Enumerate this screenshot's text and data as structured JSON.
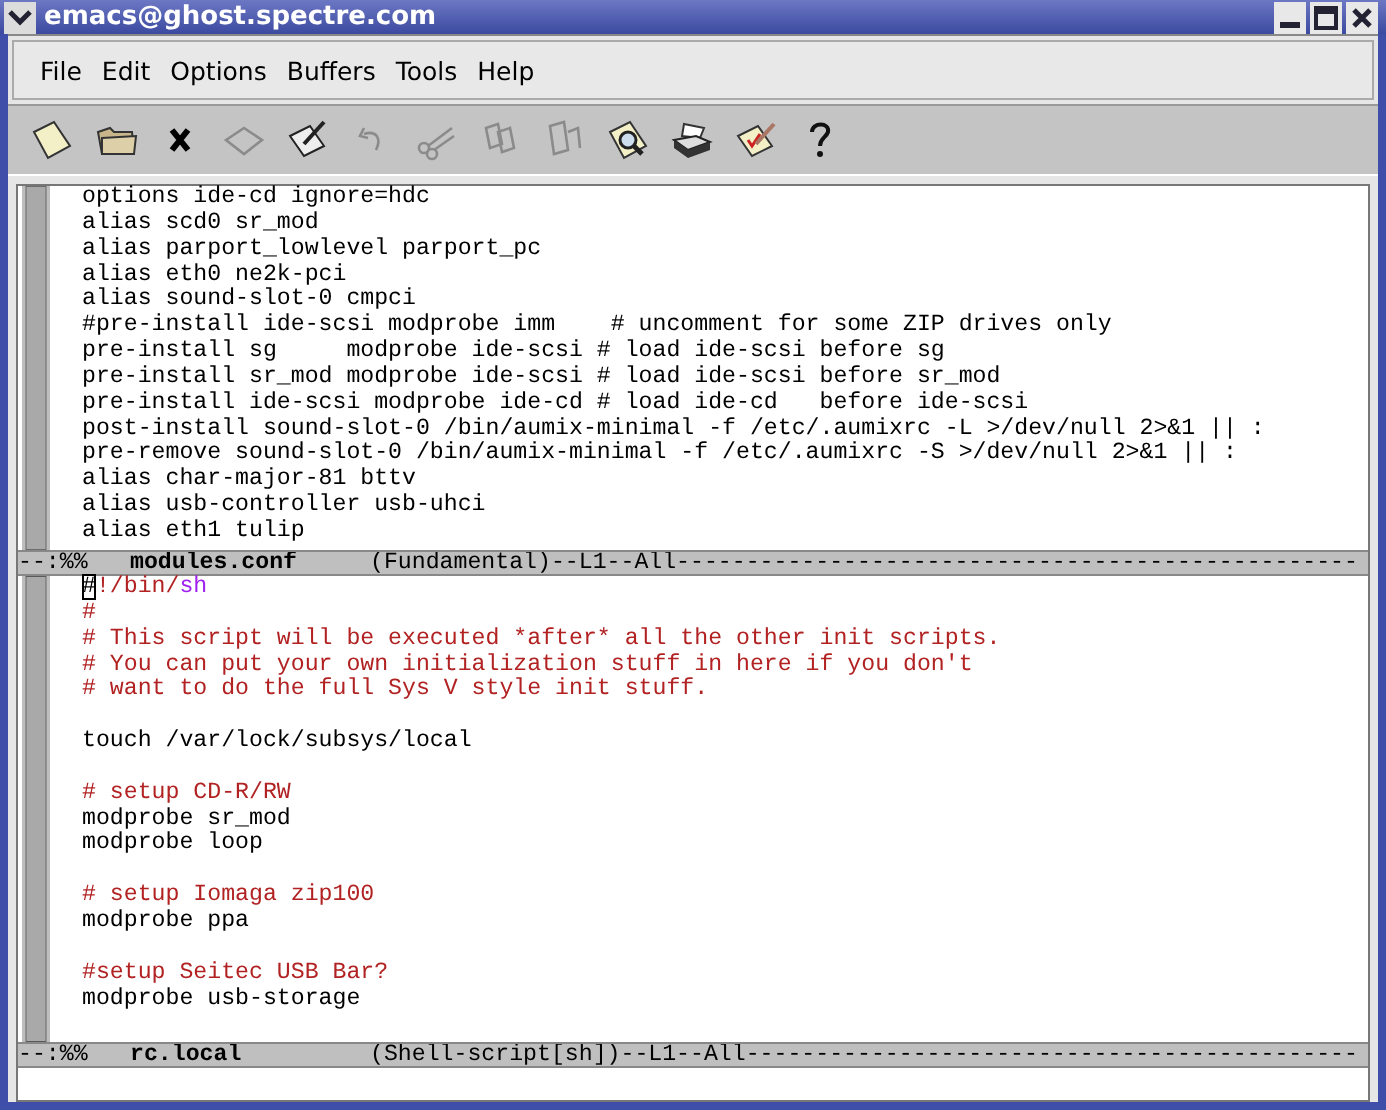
{
  "window": {
    "title": "emacs@ghost.spectre.com"
  },
  "menu": [
    {
      "label": "File"
    },
    {
      "label": "Edit"
    },
    {
      "label": "Options"
    },
    {
      "label": "Buffers"
    },
    {
      "label": "Tools"
    },
    {
      "label": "Help"
    }
  ],
  "toolbar": [
    {
      "kind": "new",
      "disabled": false
    },
    {
      "kind": "open",
      "disabled": false
    },
    {
      "kind": "close",
      "disabled": false
    },
    {
      "kind": "save",
      "disabled": true
    },
    {
      "kind": "edit",
      "disabled": false
    },
    {
      "kind": "undo",
      "disabled": true
    },
    {
      "kind": "cut",
      "disabled": true
    },
    {
      "kind": "copy",
      "disabled": true
    },
    {
      "kind": "paste",
      "disabled": true
    },
    {
      "kind": "search",
      "disabled": false
    },
    {
      "kind": "print",
      "disabled": false
    },
    {
      "kind": "check",
      "disabled": false
    },
    {
      "kind": "help",
      "disabled": false
    }
  ],
  "panes": [
    {
      "lines": [
        {
          "kind": "text",
          "segments": [
            {
              "kind": "code",
              "text": "options ide-cd ignore=hdc"
            }
          ]
        },
        {
          "kind": "text",
          "segments": [
            {
              "kind": "code",
              "text": "alias scd0 sr_mod"
            }
          ]
        },
        {
          "kind": "text",
          "segments": [
            {
              "kind": "code",
              "text": "alias parport_lowlevel parport_pc"
            }
          ]
        },
        {
          "kind": "text",
          "segments": [
            {
              "kind": "code",
              "text": "alias eth0 ne2k-pci"
            }
          ]
        },
        {
          "kind": "text",
          "segments": [
            {
              "kind": "code",
              "text": "alias sound-slot-0 cmpci"
            }
          ]
        },
        {
          "kind": "text",
          "segments": [
            {
              "kind": "code",
              "text": "#pre-install ide-scsi modprobe imm    # uncomment for some ZIP drives only"
            }
          ]
        },
        {
          "kind": "text",
          "segments": [
            {
              "kind": "code",
              "text": "pre-install sg     modprobe ide-scsi # load ide-scsi before sg"
            }
          ]
        },
        {
          "kind": "text",
          "segments": [
            {
              "kind": "code",
              "text": "pre-install sr_mod modprobe ide-scsi # load ide-scsi before sr_mod"
            }
          ]
        },
        {
          "kind": "text",
          "segments": [
            {
              "kind": "code",
              "text": "pre-install ide-scsi modprobe ide-cd # load ide-cd   before ide-scsi"
            }
          ]
        },
        {
          "kind": "text",
          "segments": [
            {
              "kind": "code",
              "text": "post-install sound-slot-0 /bin/aumix-minimal -f /etc/.aumixrc -L >/dev/null 2>&1 || :"
            }
          ]
        },
        {
          "kind": "text",
          "segments": [
            {
              "kind": "code",
              "text": "pre-remove sound-slot-0 /bin/aumix-minimal -f /etc/.aumixrc -S >/dev/null 2>&1 || :"
            }
          ]
        },
        {
          "kind": "text",
          "segments": [
            {
              "kind": "code",
              "text": "alias char-major-81 bttv"
            }
          ]
        },
        {
          "kind": "text",
          "segments": [
            {
              "kind": "code",
              "text": "alias usb-controller usb-uhci"
            }
          ]
        },
        {
          "kind": "text",
          "segments": [
            {
              "kind": "code",
              "text": "alias eth1 tulip"
            }
          ]
        }
      ],
      "mode_line": {
        "status": "--:%%",
        "buffer": "modules.conf",
        "mode": "(Fundamental)--L1--All-------------------------------------------------"
      }
    },
    {
      "lines": [
        {
          "kind": "text",
          "segments": [
            {
              "kind": "cursor",
              "text": "#"
            },
            {
              "kind": "comment",
              "text": "!/bin/"
            },
            {
              "kind": "keyword",
              "text": "sh"
            }
          ]
        },
        {
          "kind": "text",
          "segments": [
            {
              "kind": "comment",
              "text": "#"
            }
          ]
        },
        {
          "kind": "text",
          "segments": [
            {
              "kind": "comment",
              "text": "# This script will be executed *after* all the other init scripts."
            }
          ]
        },
        {
          "kind": "text",
          "segments": [
            {
              "kind": "comment",
              "text": "# You can put your own initialization stuff in here if you don't"
            }
          ]
        },
        {
          "kind": "text",
          "segments": [
            {
              "kind": "comment",
              "text": "# want to do the full Sys V style init stuff."
            }
          ]
        },
        {
          "kind": "blank"
        },
        {
          "kind": "text",
          "segments": [
            {
              "kind": "code",
              "text": "touch /var/lock/subsys/local"
            }
          ]
        },
        {
          "kind": "blank"
        },
        {
          "kind": "text",
          "segments": [
            {
              "kind": "comment",
              "text": "# setup CD-R/RW"
            }
          ]
        },
        {
          "kind": "text",
          "segments": [
            {
              "kind": "code",
              "text": "modprobe sr_mod"
            }
          ]
        },
        {
          "kind": "text",
          "segments": [
            {
              "kind": "code",
              "text": "modprobe loop"
            }
          ]
        },
        {
          "kind": "blank"
        },
        {
          "kind": "text",
          "segments": [
            {
              "kind": "comment",
              "text": "# setup Iomaga zip100"
            }
          ]
        },
        {
          "kind": "text",
          "segments": [
            {
              "kind": "code",
              "text": "modprobe ppa"
            }
          ]
        },
        {
          "kind": "blank"
        },
        {
          "kind": "text",
          "segments": [
            {
              "kind": "comment",
              "text": "#setup Seitec USB Bar?"
            }
          ]
        },
        {
          "kind": "text",
          "segments": [
            {
              "kind": "code",
              "text": "modprobe usb-storage"
            }
          ]
        }
      ],
      "mode_line": {
        "status": "--:%%",
        "buffer": "rc.local",
        "mode": "(Shell-script[sh])--L1--All--------------------------------------------"
      }
    }
  ]
}
